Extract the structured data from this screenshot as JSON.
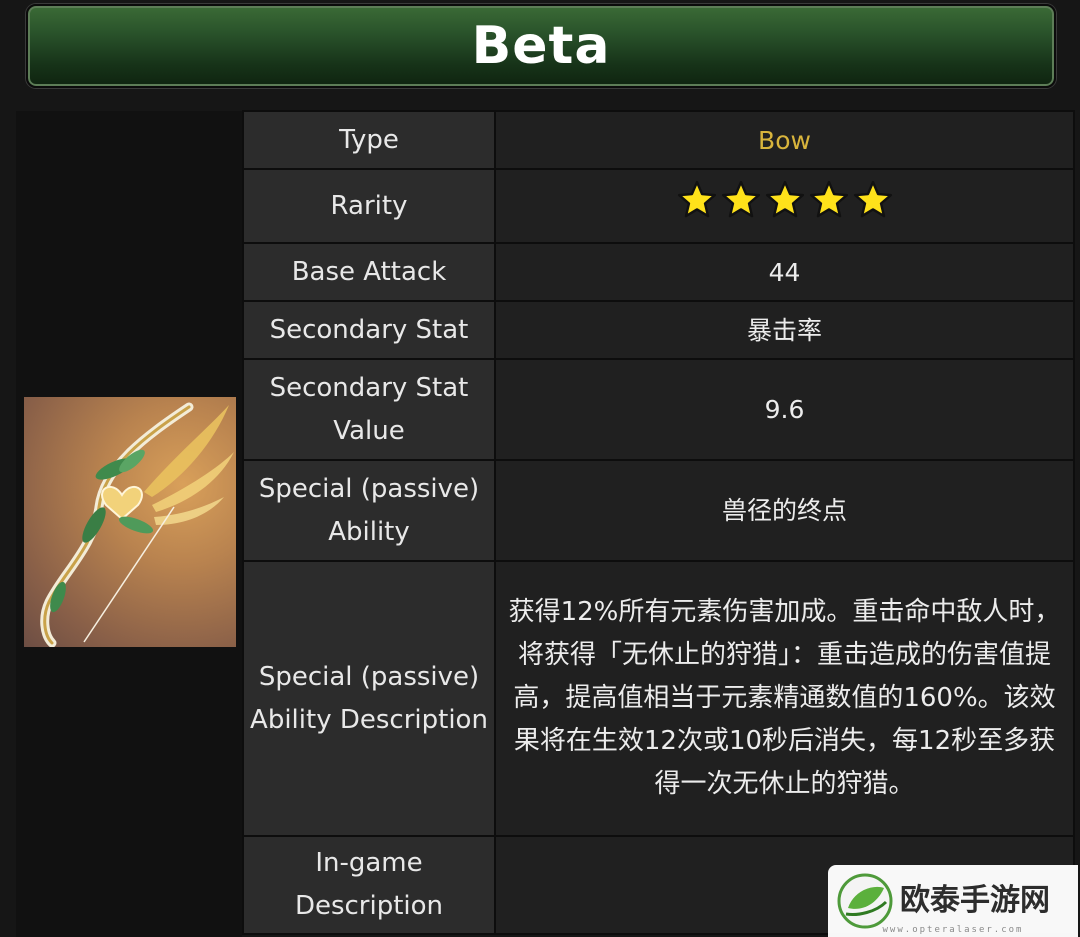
{
  "title": "Beta",
  "rows": {
    "type": {
      "label": "Type",
      "value": "Bow"
    },
    "rarity": {
      "label": "Rarity",
      "stars": 5
    },
    "base_attack": {
      "label": "Base Attack",
      "value": "44"
    },
    "secondary_stat": {
      "label": "Secondary Stat",
      "value": "暴击率"
    },
    "secondary_stat_value": {
      "label": "Secondary Stat Value",
      "value": "9.6"
    },
    "special_ability": {
      "label": "Special (passive) Ability",
      "value": "兽径的终点"
    },
    "special_ability_description": {
      "label": "Special (passive) Ability Description",
      "value": "获得12%所有元素伤害加成。重击命中敌人时，将获得「无休止的狩猎」：重击造成的伤害值提高，提高值相当于元素精通数值的160%。该效果将在生效12次或10秒后消失，每12秒至多获得一次无休止的狩猎。"
    },
    "ingame_description": {
      "label": "In-game Description",
      "value": ""
    }
  },
  "watermark": {
    "brand": "欧泰手游网",
    "site": "www.opteralaser.com"
  },
  "colors": {
    "title_green": "#29522a",
    "type_gold": "#d8b43c",
    "star_yellow": "#ffe21a"
  },
  "icons": {
    "weapon": "bow-weapon-icon",
    "rarity": "star-icon",
    "watermark_logo": "leaf-logo-icon"
  }
}
